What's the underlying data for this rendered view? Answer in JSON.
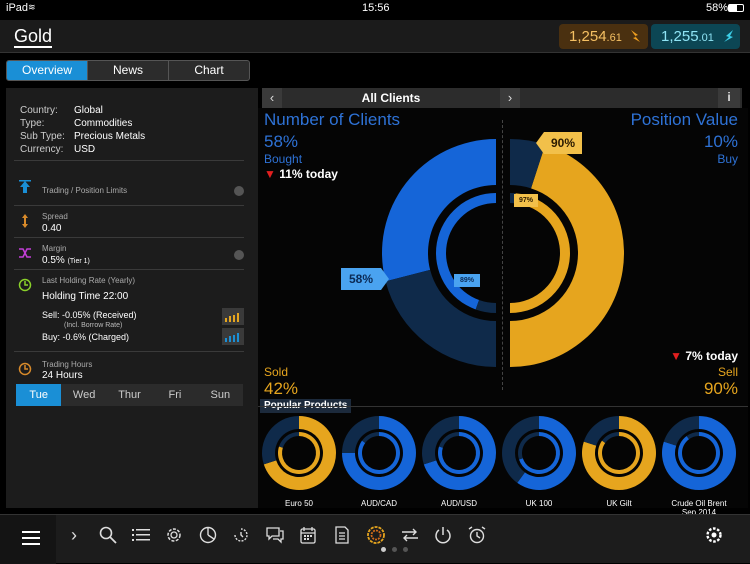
{
  "status_bar": {
    "device": "iPad",
    "time": "15:56",
    "battery": "58%"
  },
  "header": {
    "title": "Gold",
    "sell_price": {
      "main": "1,254",
      "small": ".61"
    },
    "buy_price": {
      "main": "1,255",
      "small": ".01"
    }
  },
  "tabs": [
    "Overview",
    "News",
    "Chart"
  ],
  "info": {
    "country_label": "Country:",
    "country": "Global",
    "type_label": "Type:",
    "type": "Commodities",
    "subtype_label": "Sub Type:",
    "subtype": "Precious Metals",
    "currency_label": "Currency:",
    "currency": "USD"
  },
  "limits": {
    "label": "Trading / Position Limits"
  },
  "spread": {
    "label": "Spread",
    "value": "0.40"
  },
  "margin": {
    "label": "Margin",
    "value": "0.5%",
    "tier": "(Tier 1)"
  },
  "holding": {
    "label": "Last Holding Rate (Yearly)",
    "time": "Holding Time 22:00",
    "sell": "Sell: -0.05% (Received)",
    "borrow": "(Incl. Borrow Rate)",
    "buy": "Buy: -0.6% (Charged)"
  },
  "trading_hours": {
    "label": "Trading Hours",
    "value": "24 Hours"
  },
  "days": [
    "Tue",
    "Wed",
    "Thur",
    "Fri",
    "Sun"
  ],
  "clients_nav": {
    "title": "All Clients"
  },
  "left_stats": {
    "title": "Number of Clients",
    "pct": "58%",
    "label": "Bought",
    "change": "11% today",
    "sold_label": "Sold",
    "sold_pct": "42%"
  },
  "right_stats": {
    "title": "Position Value",
    "pct": "10%",
    "label": "Buy",
    "change": "7% today",
    "sell_label": "Sell",
    "sell_pct": "90%"
  },
  "callouts": {
    "outer_left": "58%",
    "inner_left": "89%",
    "outer_right": "90%",
    "inner_right": "97%"
  },
  "chart_data": {
    "type": "pie",
    "clients": {
      "bought_outer": 58,
      "bought_inner": 89
    },
    "position": {
      "sell_outer": 90,
      "sell_inner": 97
    }
  },
  "popular": {
    "title": "Popular Products",
    "items": [
      {
        "name": "Euro 50",
        "sub": "",
        "color": "#e6a51e",
        "outer": 70,
        "inner": 80
      },
      {
        "name": "AUD/CAD",
        "sub": "",
        "color": "#1565d8",
        "outer": 75,
        "inner": 85
      },
      {
        "name": "AUD/USD",
        "sub": "",
        "color": "#1565d8",
        "outer": 70,
        "inner": 80
      },
      {
        "name": "UK 100",
        "sub": "",
        "color": "#1565d8",
        "outer": 60,
        "inner": 70
      },
      {
        "name": "UK Gilt",
        "sub": "",
        "color": "#e6a51e",
        "outer": 80,
        "inner": 85
      },
      {
        "name": "Crude Oil Brent",
        "sub": "Sep 2014",
        "color": "#1565d8",
        "outer": 80,
        "inner": 90
      }
    ]
  },
  "colors": {
    "buy": "#1565d8",
    "sell": "#e6a51e",
    "accent": "#1a8fd6",
    "down": "#e21f1f"
  }
}
